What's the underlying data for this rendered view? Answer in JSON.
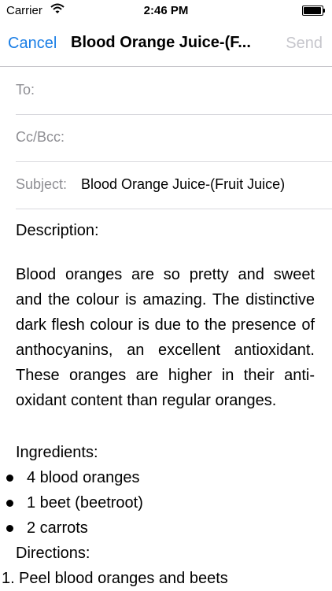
{
  "status_bar": {
    "carrier": "Carrier",
    "time": "2:46 PM"
  },
  "nav": {
    "cancel_label": "Cancel",
    "title": "Blood Orange Juice-(F...",
    "send_label": "Send"
  },
  "fields": {
    "to_label": "To:",
    "cc_label": "Cc/Bcc:",
    "subject_label": "Subject:",
    "subject_value": "Blood Orange Juice-(Fruit Juice)"
  },
  "body": {
    "description_label": "Description:",
    "description": "Blood oranges are so pretty and sweet and the colour is amazing. The distinctive dark flesh colour is due to the presence of anthocyanins, an excellent antioxidant. These oranges are higher in their anti-oxidant content than regular oranges.",
    "ingredients_label": "Ingredients:",
    "ingredients": [
      "4 blood oranges",
      "1 beet (beetroot)",
      "2 carrots"
    ],
    "directions_label": "Directions:",
    "step_number": "1.",
    "step_text": "Peel blood oranges and beets"
  },
  "colors": {
    "tint": "#1a7ee6",
    "disabled": "#c6c6cc",
    "field_label": "#8e8e93"
  }
}
